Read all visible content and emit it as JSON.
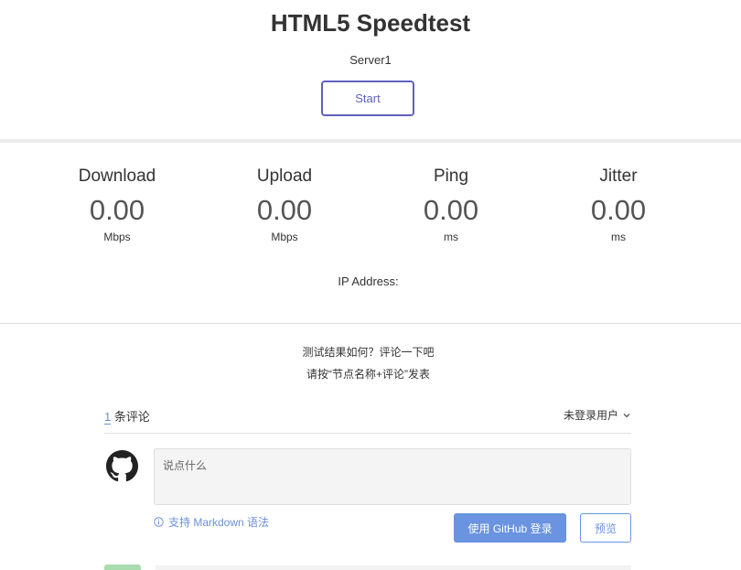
{
  "header": {
    "title": "HTML5 Speedtest",
    "server": "Server1",
    "start_label": "Start"
  },
  "meters": [
    {
      "name": "Download",
      "value": "0.00",
      "unit": "Mbps"
    },
    {
      "name": "Upload",
      "value": "0.00",
      "unit": "Mbps"
    },
    {
      "name": "Ping",
      "value": "0.00",
      "unit": "ms"
    },
    {
      "name": "Jitter",
      "value": "0.00",
      "unit": "ms"
    }
  ],
  "ip_label": "IP Address:",
  "comment_prompt": {
    "line1": "测试结果如何？评论一下吧",
    "line2": "请按“节点名称+评论”发表"
  },
  "comments": {
    "count": "1",
    "count_suffix": "条评论",
    "user_menu": "未登录用户",
    "placeholder": "说点什么",
    "markdown_tip": "支持 Markdown 语法",
    "login_button": "使用 GitHub 登录",
    "preview_button": "预览"
  },
  "colors": {
    "accent": "#6060c0",
    "link": "#6c8fd8",
    "login_bg": "#6a93e0"
  },
  "icons": [
    "github-icon",
    "chevron-down-icon",
    "info-icon"
  ]
}
